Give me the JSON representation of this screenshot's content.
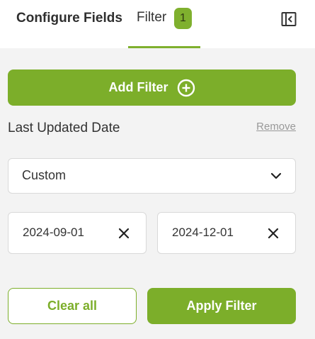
{
  "tabs": {
    "configure_label": "Configure Fields",
    "filter_label": "Filter",
    "filter_count": "1"
  },
  "add_filter_label": "Add Filter",
  "filter": {
    "field_label": "Last Updated Date",
    "remove_label": "Remove",
    "range_type": "Custom",
    "start_date": "2024-09-01",
    "end_date": "2024-12-01"
  },
  "footer": {
    "clear_label": "Clear all",
    "apply_label": "Apply Filter"
  },
  "icons": {
    "collapse": "collapse-panel-icon",
    "add": "plus-circle-icon",
    "dropdown": "chevron-down-icon",
    "clear": "close-icon"
  },
  "colors": {
    "accent": "#7cae2a",
    "badge": "#7fb02e",
    "background": "#f3f3f3"
  }
}
